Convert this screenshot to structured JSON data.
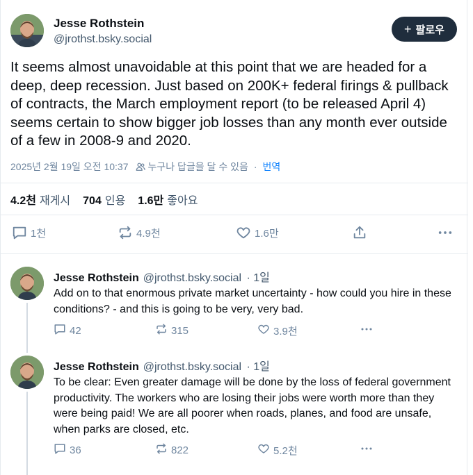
{
  "post": {
    "author_name": "Jesse Rothstein",
    "author_handle": "@jrothst.bsky.social",
    "follow_label": "팔로우",
    "text": "It seems almost unavoidable at this point that we are headed for a deep, deep recession. Just based on 200K+ federal firings & pullback of contracts, the March employment report (to be released April 4) seems certain to show bigger job losses than any month ever outside of a few in 2008-9 and 2020.",
    "timestamp": "2025년 2월 19일 오전 10:37",
    "reply_permission": "누구나 답글을 달 수 있음",
    "separator": "·",
    "translate_label": "번역",
    "stats": {
      "reposts_count": "4.2천",
      "reposts_label": "재게시",
      "quotes_count": "704",
      "quotes_label": "인용",
      "likes_count": "1.6만",
      "likes_label": "좋아요"
    },
    "actions": {
      "replies": "1천",
      "reposts": "4.9천",
      "likes": "1.6만"
    }
  },
  "replies": [
    {
      "author_name": "Jesse Rothstein",
      "author_handle": "@jrothst.bsky.social",
      "age": "· 1일",
      "text": "Add on to that enormous private market uncertainty - how could you hire in these conditions? - and this is going to be very, very bad.",
      "replies": "42",
      "reposts": "315",
      "likes": "3.9천"
    },
    {
      "author_name": "Jesse Rothstein",
      "author_handle": "@jrothst.bsky.social",
      "age": "· 1일",
      "text": "To be clear: Even greater damage will be done by the loss of federal government productivity. The workers who are losing their jobs were worth more than they were being paid! We are all poorer when roads, planes, and food are unsafe, when parks are closed, etc.",
      "replies": "36",
      "reposts": "822",
      "likes": "5.2천"
    }
  ],
  "colors": {
    "accent": "#1083fe",
    "muted": "#6f869f",
    "button_bg": "#1f2d3d",
    "divider": "#e6eaee"
  }
}
